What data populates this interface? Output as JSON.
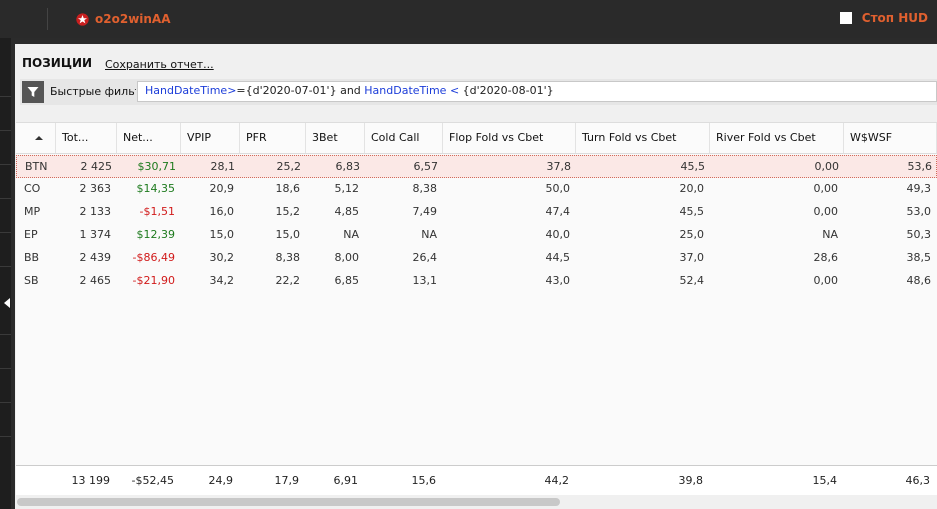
{
  "app": {
    "brand": "o2o2winAA",
    "hud_label": "Стоп HUD"
  },
  "panel": {
    "title": "ПОЗИЦИИ",
    "save_report": "Сохранить отчет..."
  },
  "filter": {
    "label": "Быстрые фильт",
    "kw1": "HandDateTime",
    "op1": ">",
    "val1": "={d'2020-07-01'} and ",
    "kw2": "HandDateTime",
    "op2": " < ",
    "val2": "{d'2020-08-01'}"
  },
  "columns": [
    "",
    "Tot...",
    "Net...",
    "VPIP",
    "PFR",
    "3Bet",
    "Cold Call",
    "Flop Fold vs Cbet",
    "Turn Fold vs Cbet",
    "River Fold vs Cbet",
    "W$WSF"
  ],
  "rows": [
    {
      "pos": "BTN",
      "tot": "2 425",
      "net": "$30,71",
      "net_sign": "pos",
      "vpip": "28,1",
      "pfr": "25,2",
      "threebet": "6,83",
      "coldcall": "6,57",
      "flop": "37,8",
      "turn": "45,5",
      "river": "0,00",
      "wwsf": "53,6",
      "selected": true
    },
    {
      "pos": "CO",
      "tot": "2 363",
      "net": "$14,35",
      "net_sign": "pos",
      "vpip": "20,9",
      "pfr": "18,6",
      "threebet": "5,12",
      "coldcall": "8,38",
      "flop": "50,0",
      "turn": "20,0",
      "river": "0,00",
      "wwsf": "49,3"
    },
    {
      "pos": "MP",
      "tot": "2 133",
      "net": "-$1,51",
      "net_sign": "neg",
      "vpip": "16,0",
      "pfr": "15,2",
      "threebet": "4,85",
      "coldcall": "7,49",
      "flop": "47,4",
      "turn": "45,5",
      "river": "0,00",
      "wwsf": "53,0"
    },
    {
      "pos": "EP",
      "tot": "1 374",
      "net": "$12,39",
      "net_sign": "pos",
      "vpip": "15,0",
      "pfr": "15,0",
      "threebet": "NA",
      "coldcall": "NA",
      "flop": "40,0",
      "turn": "25,0",
      "river": "NA",
      "wwsf": "50,3"
    },
    {
      "pos": "BB",
      "tot": "2 439",
      "net": "-$86,49",
      "net_sign": "neg",
      "vpip": "30,2",
      "pfr": "8,38",
      "threebet": "8,00",
      "coldcall": "26,4",
      "flop": "44,5",
      "turn": "37,0",
      "river": "28,6",
      "wwsf": "38,5"
    },
    {
      "pos": "SB",
      "tot": "2 465",
      "net": "-$21,90",
      "net_sign": "neg",
      "vpip": "34,2",
      "pfr": "22,2",
      "threebet": "6,85",
      "coldcall": "13,1",
      "flop": "43,0",
      "turn": "52,4",
      "river": "0,00",
      "wwsf": "48,6"
    }
  ],
  "totals": {
    "tot": "13 199",
    "net": "-$52,45",
    "vpip": "24,9",
    "pfr": "17,9",
    "threebet": "6,91",
    "coldcall": "15,6",
    "flop": "44,2",
    "turn": "39,8",
    "river": "15,4",
    "wwsf": "46,3"
  },
  "colors": {
    "accent": "#e0602f",
    "positive": "#1d7a1d",
    "negative": "#d11a1a",
    "keyword": "#1c3dd9"
  }
}
